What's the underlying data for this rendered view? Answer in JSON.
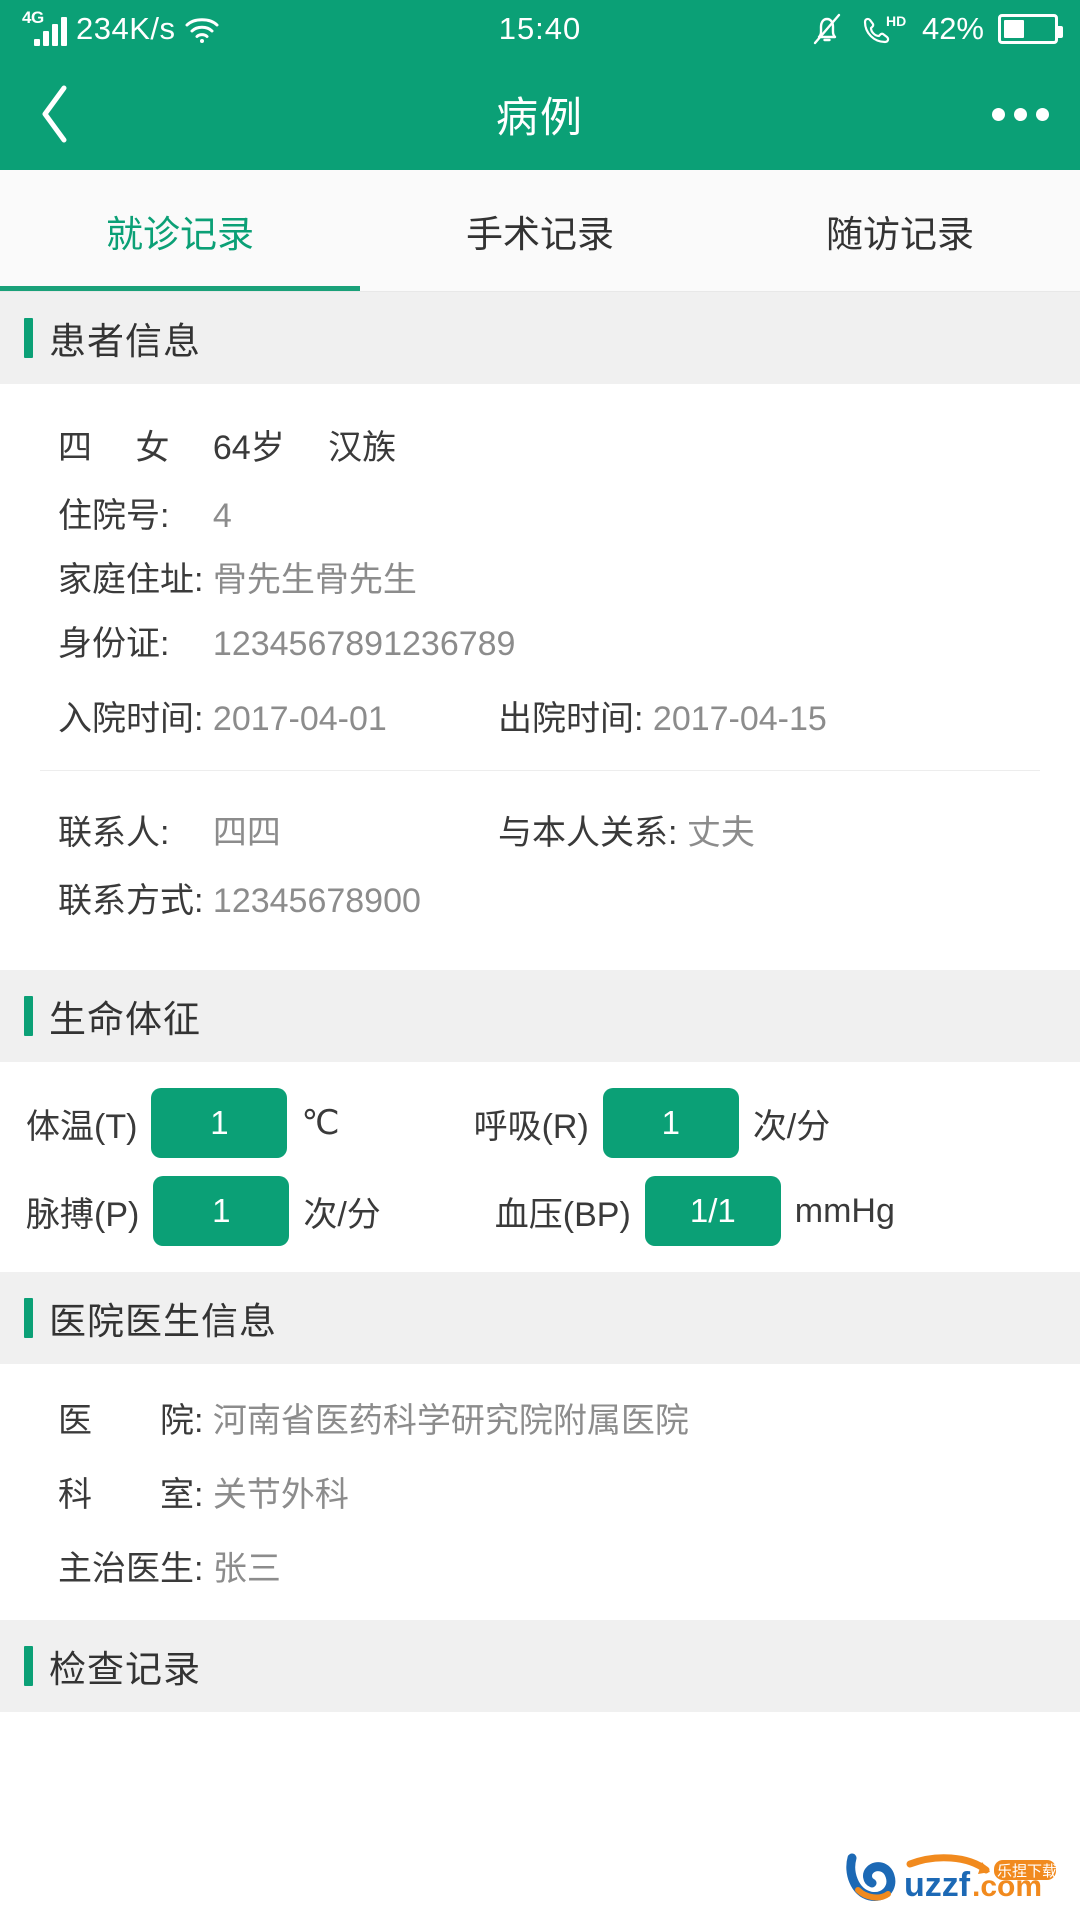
{
  "status_bar": {
    "network_type": "4G",
    "net_speed": "234K/s",
    "time": "15:40",
    "battery_percent": "42%",
    "icons": [
      "signal-bars-icon",
      "wifi-icon",
      "bell-muted-icon",
      "phone-hd-icon",
      "battery-icon"
    ]
  },
  "nav": {
    "title": "病例",
    "back_icon": "chevron-left-icon",
    "more_icon": "more-horizontal-icon"
  },
  "tabs": [
    {
      "label": "就诊记录",
      "active": true
    },
    {
      "label": "手术记录",
      "active": false
    },
    {
      "label": "随访记录",
      "active": false
    }
  ],
  "patient_section": {
    "title": "患者信息",
    "summary": "四　 女　 64岁　 汉族",
    "name": "四",
    "gender": "女",
    "age": "64岁",
    "ethnicity": "汉族",
    "fields": [
      {
        "label": "住院号:　 ",
        "value": "4"
      },
      {
        "label": "家庭住址: ",
        "value": "骨先生骨先生"
      },
      {
        "label": "身份证:　 ",
        "value": "1234567891236789"
      }
    ],
    "admission_label": "入院时间: ",
    "admission_value": "2017-04-01",
    "discharge_label": "出院时间: ",
    "discharge_value": "2017-04-15",
    "contact_label": "联系人:　 ",
    "contact_value": "四四",
    "relation_label": "与本人关系: ",
    "relation_value": "丈夫",
    "phone_label": "联系方式: ",
    "phone_value": "12345678900"
  },
  "vitals_section": {
    "title": "生命体征",
    "items": [
      {
        "label": "体温(T)",
        "value": "1",
        "unit": "℃"
      },
      {
        "label": "呼吸(R)",
        "value": "1",
        "unit": "次/分"
      },
      {
        "label": "脉搏(P)",
        "value": "1",
        "unit": "次/分"
      },
      {
        "label": "血压(BP)",
        "value": "1/1",
        "unit": "mmHg"
      }
    ]
  },
  "hospital_section": {
    "title": "医院医生信息",
    "hospital_label": "医　　院: ",
    "hospital_value": "河南省医药科学研究院附属医院",
    "department_label": "科　　室: ",
    "department_value": "关节外科",
    "doctor_label": "主治医生: ",
    "doctor_value": "张三"
  },
  "exam_section": {
    "title": "检查记录"
  },
  "watermark": {
    "brand": "uzzf",
    "domain": ".com",
    "tagline": "乐捏下载"
  },
  "colors": {
    "accent": "#0ba076",
    "tab_active": "#0ba076",
    "section_bg": "#f0f0f0",
    "label": "#3a3a3a",
    "value": "#8c8c8c"
  }
}
